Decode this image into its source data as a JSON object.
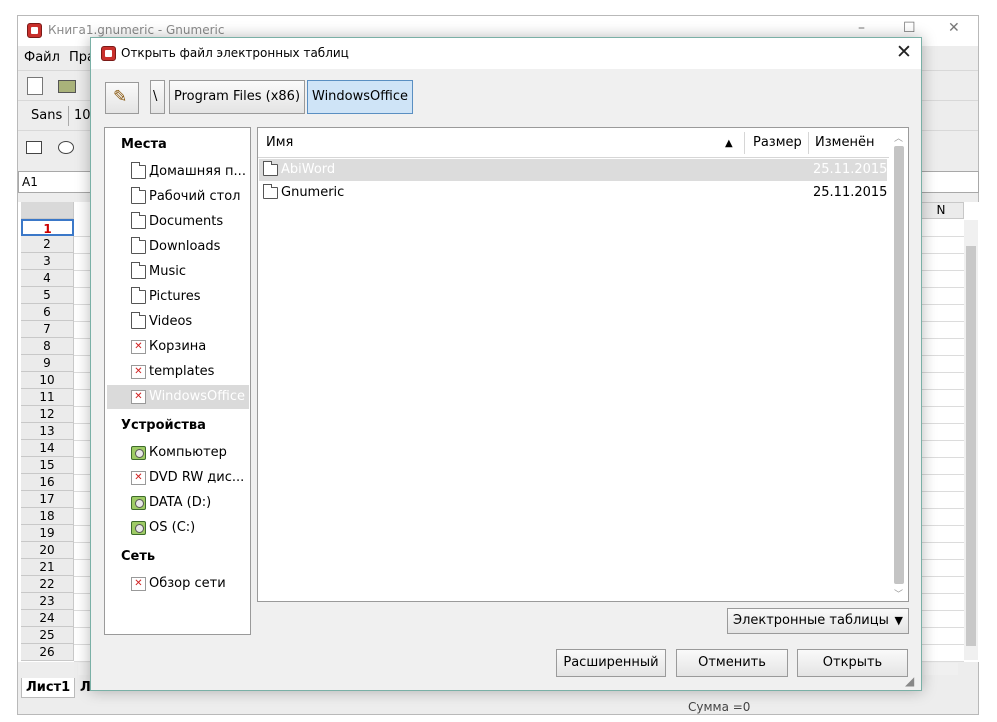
{
  "app_window": {
    "title": "Книга1.gnumeric - Gnumeric",
    "controls": {
      "minimize": "–",
      "maximize": "☐",
      "close": "✕"
    },
    "menu": [
      "Файл",
      "Пра"
    ],
    "font_name": "Sans",
    "font_size": "10",
    "cell_ref": "A1",
    "visible_column": "N",
    "rows": [
      "1",
      "2",
      "3",
      "4",
      "5",
      "6",
      "7",
      "8",
      "9",
      "10",
      "11",
      "12",
      "13",
      "14",
      "15",
      "16",
      "17",
      "18",
      "19",
      "20",
      "21",
      "22",
      "23",
      "24",
      "25",
      "26"
    ],
    "sheet_tab": "Лист1",
    "sheet_tab2": "Л",
    "status": "Сумма  =0"
  },
  "dialog": {
    "title": "Открыть файл электронных таблиц",
    "close_glyph": "✕",
    "edit_location_glyph": "✎",
    "path_root": "\\",
    "path": [
      "Program Files (x86)",
      "WindowsOffice"
    ],
    "places_title": "Места",
    "places": [
      {
        "label": "Домашняя п...",
        "icon": "folder-icon"
      },
      {
        "label": "Рабочий стол",
        "icon": "folder-icon"
      },
      {
        "label": "Documents",
        "icon": "folder-icon"
      },
      {
        "label": "Downloads",
        "icon": "folder-icon"
      },
      {
        "label": "Music",
        "icon": "folder-icon"
      },
      {
        "label": "Pictures",
        "icon": "folder-icon"
      },
      {
        "label": "Videos",
        "icon": "folder-icon"
      },
      {
        "label": "Корзина",
        "icon": "missing-icon"
      },
      {
        "label": "templates",
        "icon": "missing-icon"
      },
      {
        "label": "WindowsOffice",
        "icon": "missing-icon",
        "selected": true
      }
    ],
    "devices_title": "Устройства",
    "devices": [
      {
        "label": "Компьютер",
        "icon": "drive-icon"
      },
      {
        "label": "DVD RW дис...",
        "icon": "missing-icon"
      },
      {
        "label": "DATA (D:)",
        "icon": "drive-icon"
      },
      {
        "label": "OS (C:)",
        "icon": "drive-icon"
      }
    ],
    "network_title": "Сеть",
    "network": [
      {
        "label": "Обзор сети",
        "icon": "missing-icon"
      }
    ],
    "columns": {
      "name": "Имя",
      "size": "Размер",
      "modified": "Изменён",
      "sort_indicator": "▲"
    },
    "files": [
      {
        "name": "AbiWord",
        "size": "",
        "modified": "25.11.2015",
        "selected": true
      },
      {
        "name": "Gnumeric",
        "size": "",
        "modified": "25.11.2015",
        "selected": false
      }
    ],
    "filter": {
      "value": "Электронные таблицы",
      "arrow": "▼"
    },
    "buttons": {
      "advanced": "Расширенный",
      "cancel": "Отменить",
      "open": "Открыть"
    }
  }
}
